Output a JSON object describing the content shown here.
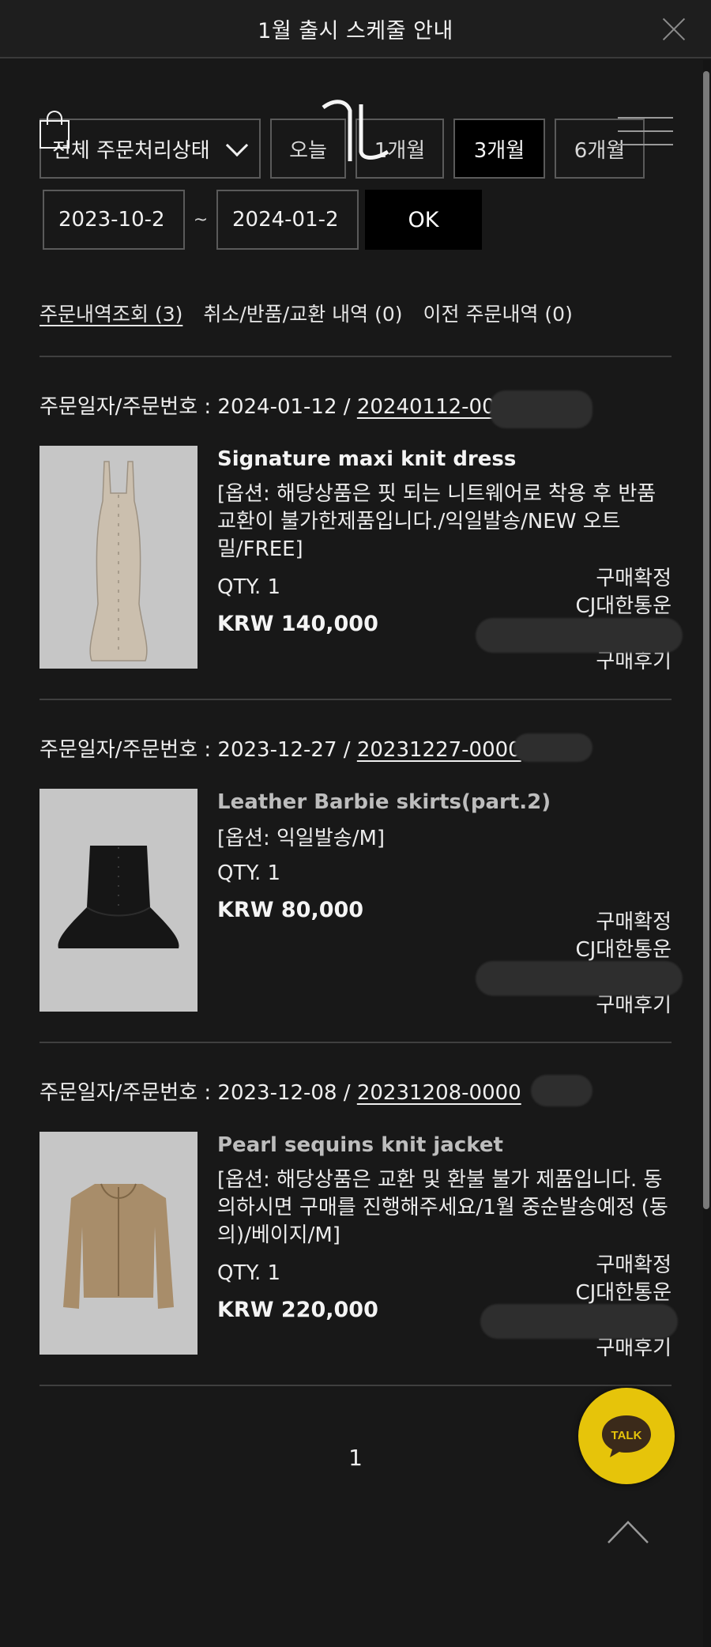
{
  "notice": {
    "title": "1월 출시 스케줄 안내"
  },
  "filters": {
    "status_select": "전체 주문처리상태",
    "periods": [
      {
        "label": "오늘",
        "active": false
      },
      {
        "label": "1개월",
        "active": false
      },
      {
        "label": "3개월",
        "active": true
      },
      {
        "label": "6개월",
        "active": false
      }
    ],
    "date_from": "2023-10-2",
    "date_separator": "~",
    "date_to": "2024-01-2",
    "ok_label": "OK"
  },
  "tabs": [
    {
      "label": "주문내역조회 (3)",
      "active": true
    },
    {
      "label": "취소/반품/교환 내역 (0)",
      "active": false
    },
    {
      "label": "이전 주문내역 (0)",
      "active": false
    }
  ],
  "orders": [
    {
      "head_label": "주문일자/주문번호 : 2024-01-12 / ",
      "order_no": "20240112-00000",
      "product_name": "Signature maxi knit dress",
      "options": "[옵션: 해당상품은 핏 되는 니트웨어로 착용 후 반품 교환이 불가한제품입니다./익일발송/NEW 오트밀/FREE]",
      "qty": "QTY. 1",
      "price": "KRW 140,000",
      "status": "구매확정",
      "courier": "CJ대한통운",
      "review": "구매후기"
    },
    {
      "head_label": "주문일자/주문번호 : 2023-12-27 / ",
      "order_no": "20231227-0000",
      "product_name": "Leather Barbie skirts(part.2)",
      "options": "[옵션: 익일발송/M]",
      "qty": "QTY. 1",
      "price": "KRW 80,000",
      "status": "구매확정",
      "courier": "CJ대한통운",
      "review": "구매후기"
    },
    {
      "head_label": "주문일자/주문번호 : 2023-12-08 / ",
      "order_no": "20231208-0000",
      "product_name": "Pearl sequins knit jacket",
      "options": "[옵션: 해당상품은 교환 및 환불 불가 제품입니다. 동의하시면 구매를 진행해주세요/1월 중순발송예정 (동의)/베이지/M]",
      "qty": "QTY. 1",
      "price": "KRW 220,000",
      "status": "구매확정",
      "courier": "CJ대한통운",
      "review": "구매후기"
    }
  ],
  "pagination": {
    "current": "1"
  },
  "talk": {
    "label": "TALK",
    "color": "#e6c40a"
  }
}
